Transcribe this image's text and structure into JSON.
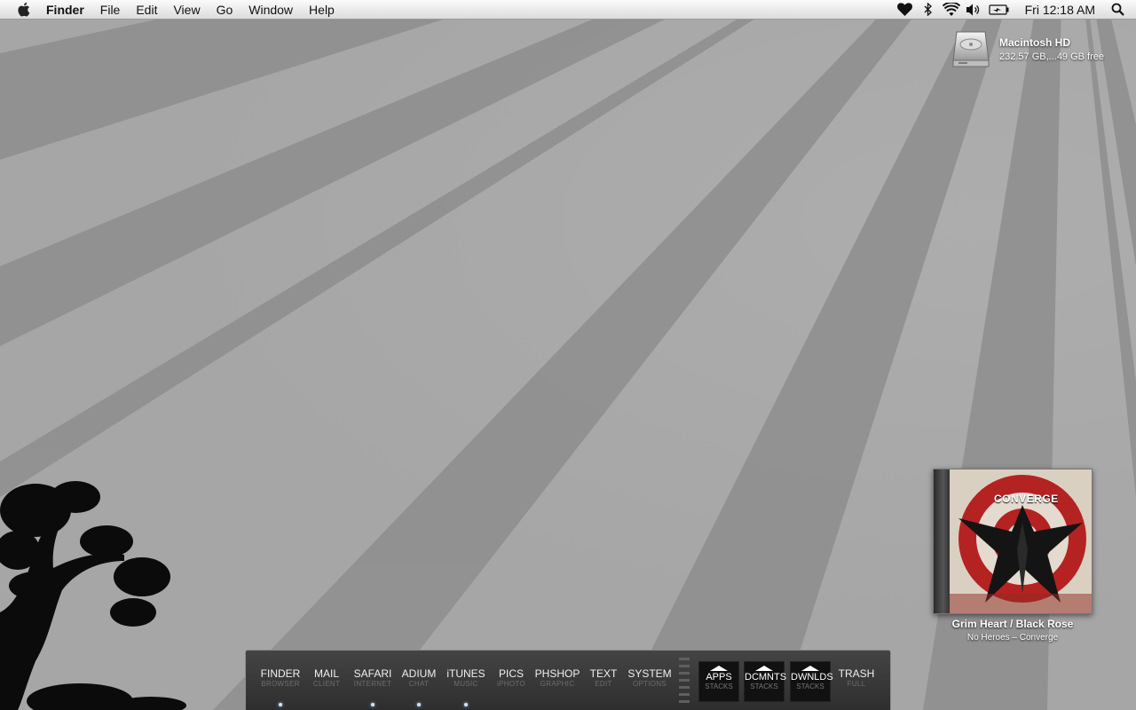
{
  "menubar": {
    "app_name": "Finder",
    "items": [
      "File",
      "Edit",
      "View",
      "Go",
      "Window",
      "Help"
    ],
    "icons": [
      "apple-icon",
      "heart-icon",
      "bluetooth-icon",
      "wifi-icon",
      "volume-icon",
      "battery-icon",
      "spotlight-icon"
    ],
    "clock": "Fri 12:18 AM"
  },
  "desktop": {
    "drive": {
      "name": "Macintosh HD",
      "info": "232.57 GB,...49 GB free",
      "icon": "hard-drive-icon"
    }
  },
  "now_playing": {
    "album_brand": "CONVERGE",
    "title": "Grim Heart / Black Rose",
    "subtitle": "No Heroes – Converge"
  },
  "dock": {
    "apps": [
      {
        "label": "FINDER",
        "sub": "BROWSER",
        "running": true
      },
      {
        "label": "MAIL",
        "sub": "CLIENT",
        "running": false
      },
      {
        "label": "SAFARI",
        "sub": "INTERNET",
        "running": true
      },
      {
        "label": "ADIUM",
        "sub": "CHAT",
        "running": true
      },
      {
        "label": "iTUNES",
        "sub": "MUSIC",
        "running": true
      },
      {
        "label": "PICS",
        "sub": "iPHOTO",
        "running": false
      },
      {
        "label": "PHSHOP",
        "sub": "GRAPHIC",
        "running": false
      },
      {
        "label": "TEXT",
        "sub": "EDIT",
        "running": false
      },
      {
        "label": "SYSTEM",
        "sub": "OPTIONS",
        "running": false
      }
    ],
    "stacks": [
      {
        "label": "APPS",
        "sub": "STACKS"
      },
      {
        "label": "DCMNTS",
        "sub": "STACKS"
      },
      {
        "label": "DWNLDS",
        "sub": "STACKS"
      }
    ],
    "trash": {
      "label": "TRASH",
      "sub": "FULL"
    }
  },
  "colors": {
    "wallpaper": "#a6a6a6",
    "dock": "#3a3a3a",
    "menubar": "#ececec"
  }
}
